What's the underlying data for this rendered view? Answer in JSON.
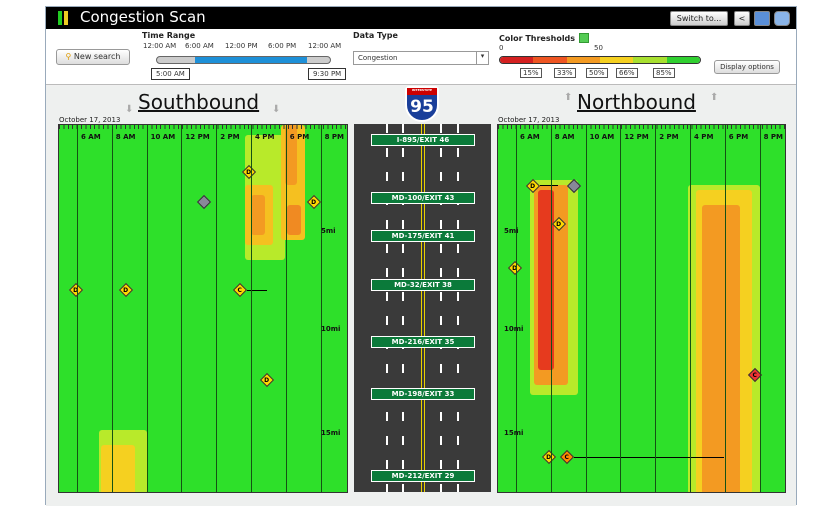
{
  "app": {
    "title": "Congestion Scan",
    "switch_label": "Switch to...",
    "icons": [
      "share-icon",
      "save-icon",
      "help-icon"
    ]
  },
  "toolbar": {
    "new_search": "New search",
    "time_range": {
      "label": "Time Range",
      "ticks": [
        "12:00 AM",
        "6:00 AM",
        "12:00 PM",
        "6:00 PM",
        "12:00 AM"
      ],
      "start": "5:00 AM",
      "end": "9:30 PM"
    },
    "data_type": {
      "label": "Data Type",
      "value": "Congestion"
    },
    "thresholds": {
      "label": "Color Thresholds",
      "scale": [
        "0",
        "50"
      ],
      "markers": [
        "15%",
        "33%",
        "50%",
        "66%",
        "85%"
      ],
      "colors": [
        "#d42020",
        "#ee5522",
        "#f39a22",
        "#f5d020",
        "#a8e030",
        "#30d030"
      ]
    },
    "display_options": "Display options"
  },
  "route": {
    "shield": "95",
    "shield_top": "INTERSTATE"
  },
  "southbound": {
    "title": "Southbound",
    "date": "October 17, 2013",
    "times": [
      "6 AM",
      "8 AM",
      "10 AM",
      "12 PM",
      "2 PM",
      "4 PM",
      "6 PM",
      "8 PM"
    ],
    "miles": [
      "5mi",
      "10mi",
      "15mi"
    ]
  },
  "northbound": {
    "title": "Northbound",
    "date": "October 17, 2013",
    "times": [
      "6 AM",
      "8 AM",
      "10 AM",
      "12 PM",
      "2 PM",
      "4 PM",
      "6 PM",
      "8 PM"
    ],
    "miles": [
      "5mi",
      "10mi",
      "15mi"
    ]
  },
  "exits": [
    "I-895/EXIT 46",
    "MD-100/EXIT 43",
    "MD-175/EXIT 41",
    "MD-32/EXIT 38",
    "MD-216/EXIT 35",
    "MD-198/EXIT 33",
    "MD-212/EXIT 29"
  ],
  "incident_labels": {
    "disabled": "D",
    "work": "W",
    "crash": "C"
  }
}
